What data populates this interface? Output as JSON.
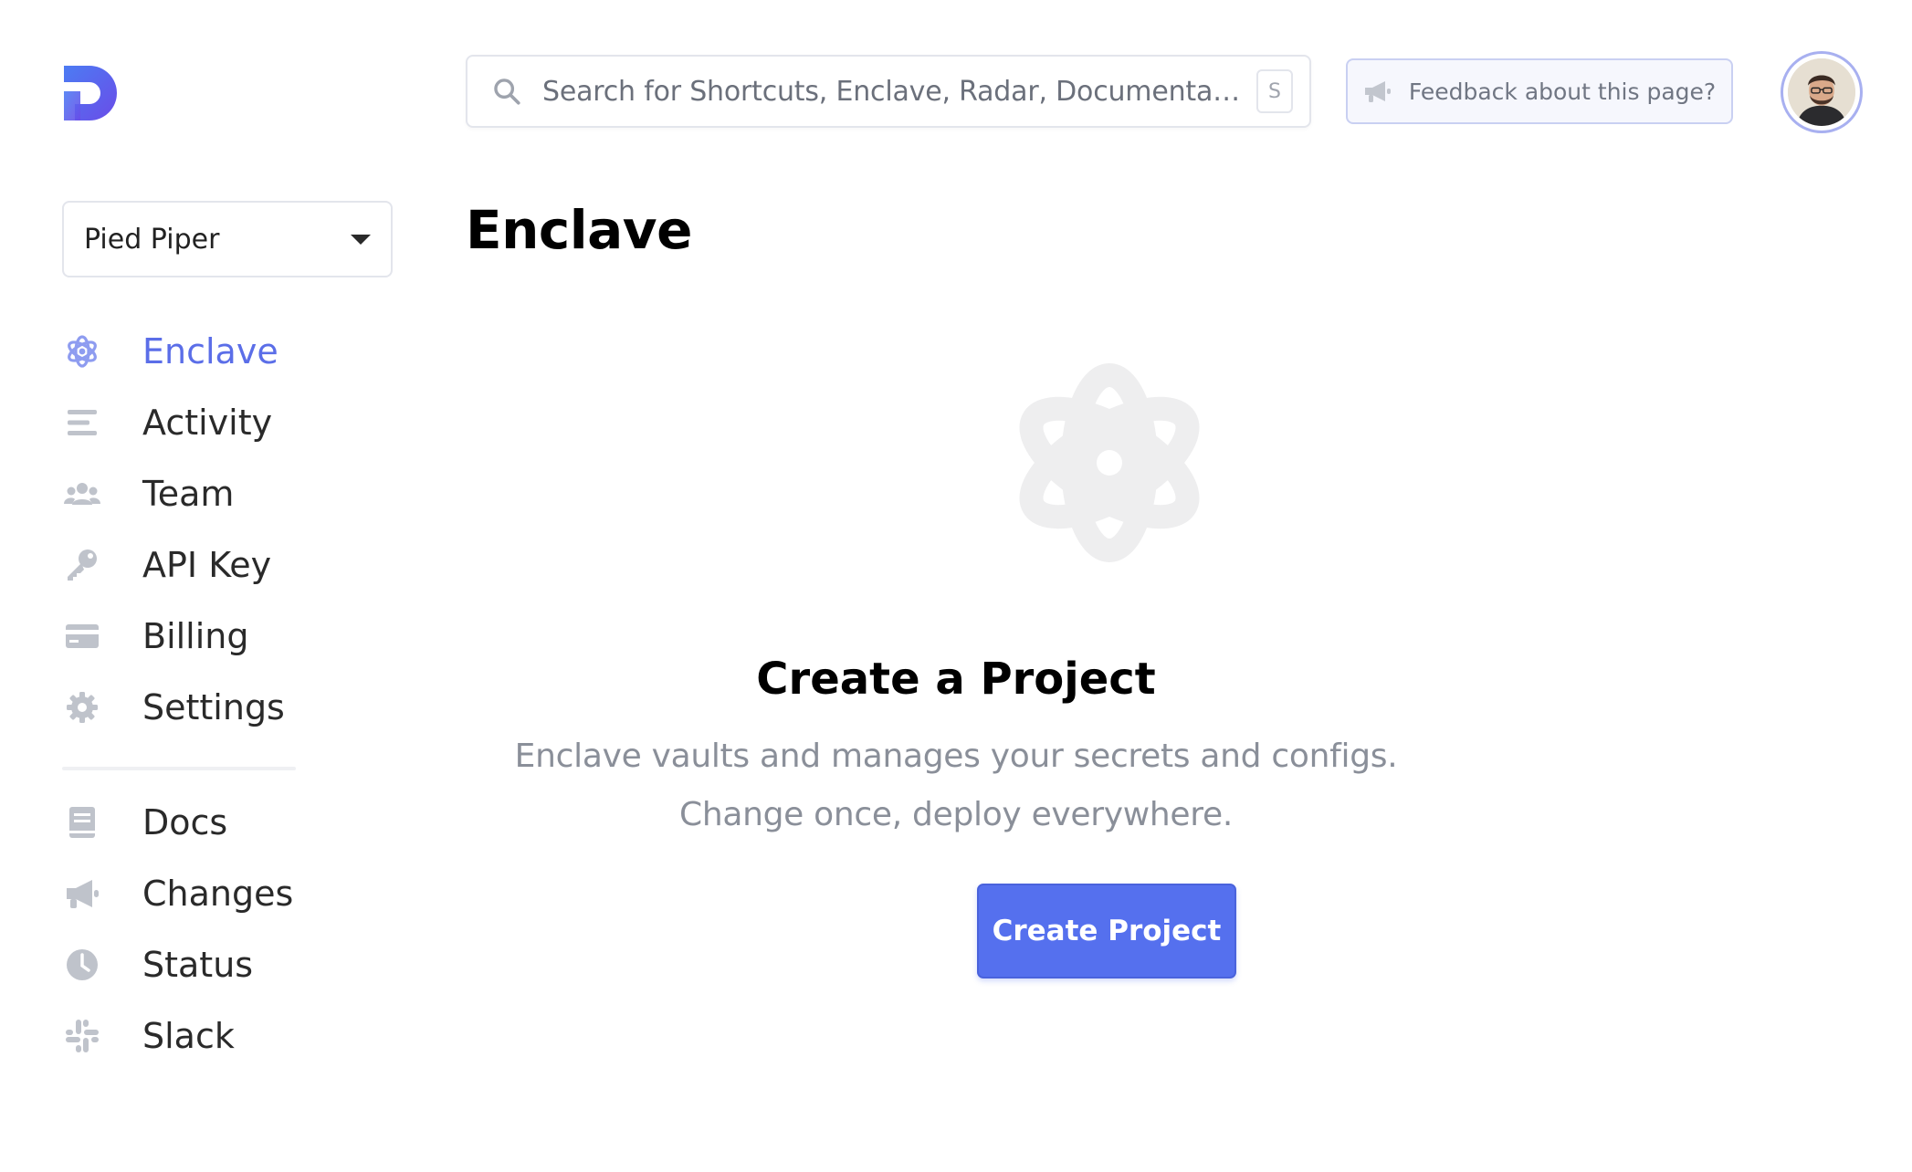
{
  "header": {
    "search_placeholder": "Search for Shortcuts, Enclave, Radar, Documentation...",
    "search_shortcut": "S",
    "feedback_label": "Feedback about this page?"
  },
  "sidebar": {
    "workspace": "Pied Piper",
    "primary_items": [
      {
        "label": "Enclave",
        "icon": "atom-icon",
        "active": true
      },
      {
        "label": "Activity",
        "icon": "activity-icon",
        "active": false
      },
      {
        "label": "Team",
        "icon": "team-icon",
        "active": false
      },
      {
        "label": "API Key",
        "icon": "key-icon",
        "active": false
      },
      {
        "label": "Billing",
        "icon": "credit-card-icon",
        "active": false
      },
      {
        "label": "Settings",
        "icon": "gear-icon",
        "active": false
      }
    ],
    "secondary_items": [
      {
        "label": "Docs",
        "icon": "book-icon"
      },
      {
        "label": "Changes",
        "icon": "megaphone-icon"
      },
      {
        "label": "Status",
        "icon": "clock-icon"
      },
      {
        "label": "Slack",
        "icon": "slack-icon"
      }
    ]
  },
  "main": {
    "title": "Enclave",
    "empty_state": {
      "title": "Create a Project",
      "line1": "Enclave vaults and manages your secrets and configs.",
      "line2": "Change once, deploy everywhere.",
      "button": "Create Project"
    }
  },
  "colors": {
    "accent": "#5570ee",
    "active_nav": "#5b6ee8",
    "icon_gray": "#bfc3cb",
    "muted_text": "#8a8f99"
  }
}
